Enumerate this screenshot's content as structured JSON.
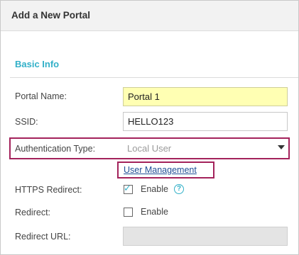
{
  "dialog": {
    "title": "Add a New Portal"
  },
  "basic_info": {
    "section_title": "Basic Info",
    "portal_name": {
      "label": "Portal Name:",
      "value": "Portal 1"
    },
    "ssid": {
      "label": "SSID:",
      "value": "HELLO123"
    },
    "authentication_type": {
      "label": "Authentication Type:",
      "value": "Local User",
      "icon": "chevron-down-icon"
    },
    "user_management_link": "User Management",
    "https_redirect": {
      "label": "HTTPS Redirect:",
      "checked": true,
      "checkbox_label": "Enable",
      "help_icon": "?"
    },
    "redirect": {
      "label": "Redirect:",
      "checked": false,
      "checkbox_label": "Enable"
    },
    "redirect_url": {
      "label": "Redirect URL:",
      "value": "",
      "disabled": true
    }
  },
  "colors": {
    "accent": "#32b0c8",
    "highlight_border": "#a3225b",
    "link": "#1f4e96",
    "highlighted_input_bg": "#ffffb3"
  }
}
